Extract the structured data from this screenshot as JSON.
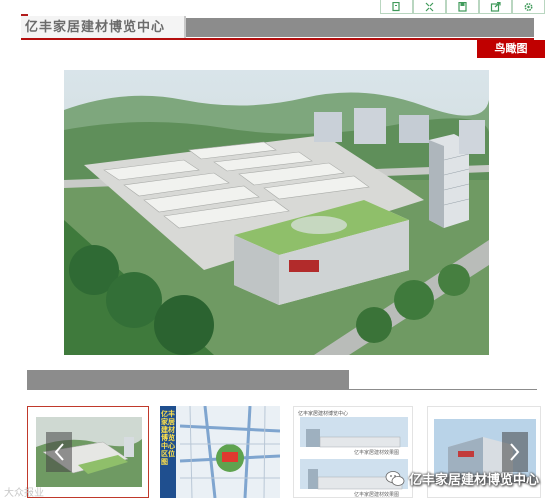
{
  "header": {
    "title": "亿丰家居建材博览中心",
    "section_tag": "鸟瞰图"
  },
  "toolbar": {
    "buttons": [
      {
        "name": "copy-icon"
      },
      {
        "name": "fullscreen-icon"
      },
      {
        "name": "save-icon"
      },
      {
        "name": "share-icon"
      },
      {
        "name": "settings-icon"
      }
    ]
  },
  "thumbnails": {
    "t2_banner": "亿丰家居建材博览中心区位图",
    "t3_caption_top": "亿丰家居建材博览中心",
    "t3_caption_mid": "亿丰家居建材效果图",
    "t3_caption_bottom": "亿丰家居建材效果图"
  },
  "watermark": {
    "left_text": "大众报业",
    "text": "亿丰家居建材博览中心"
  },
  "colors": {
    "accent_red": "#c00000",
    "header_gray": "#8c8c8c",
    "toolbar_border": "#b9d6c0",
    "icon_green": "#3f9a5a"
  }
}
